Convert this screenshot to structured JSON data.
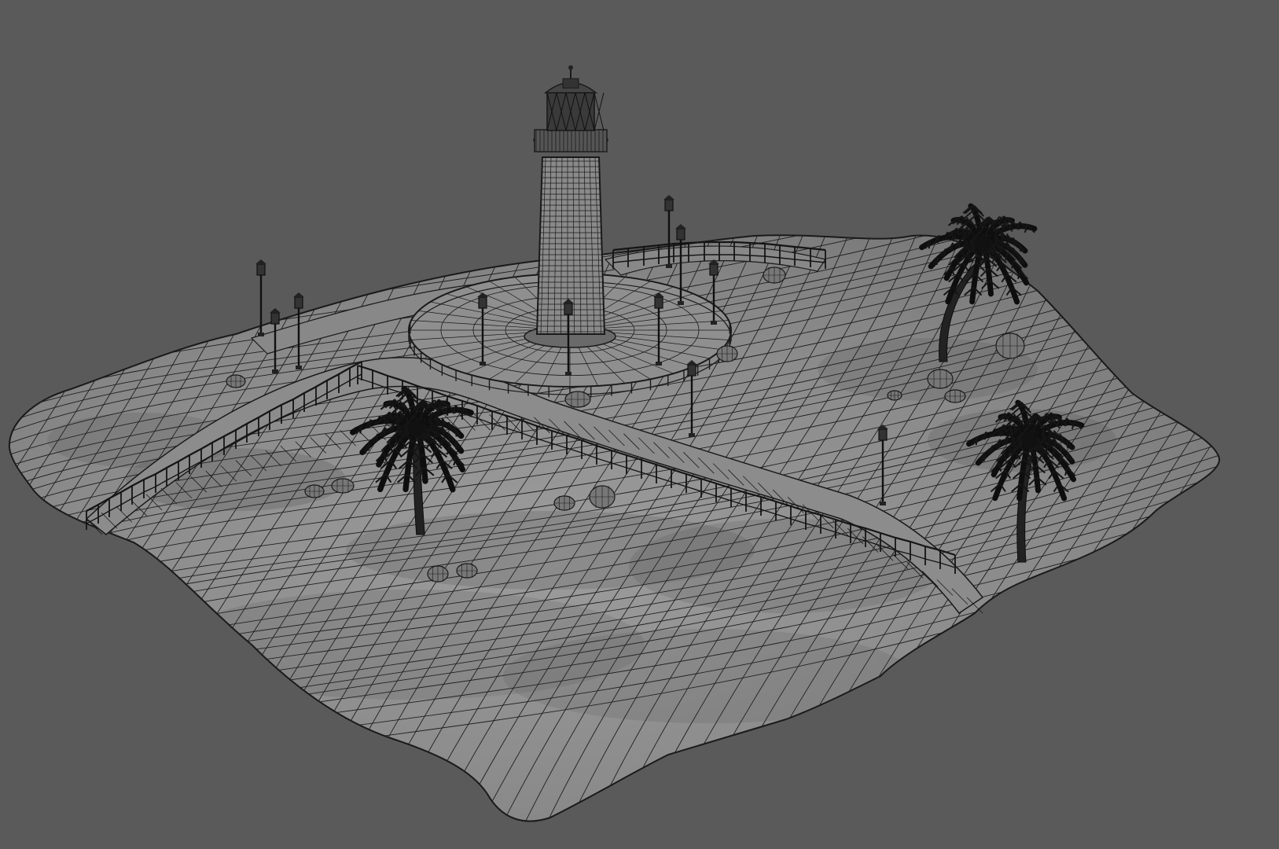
{
  "viewport": {
    "background": "#5a5a5a",
    "shading": "wireframe-on-shaded",
    "wire_color": "#1a1a1a",
    "surface_light": "#9a9a9a",
    "surface_dark": "#6e6e6e"
  },
  "scene": {
    "objects": [
      "lighthouse",
      "circular-plaza",
      "boardwalk-railing",
      "palm-tree",
      "street-lamp",
      "rock",
      "terrain-mesh"
    ],
    "palm_tree_count": 3,
    "street_lamp_count": 11,
    "rock_count": 14
  }
}
